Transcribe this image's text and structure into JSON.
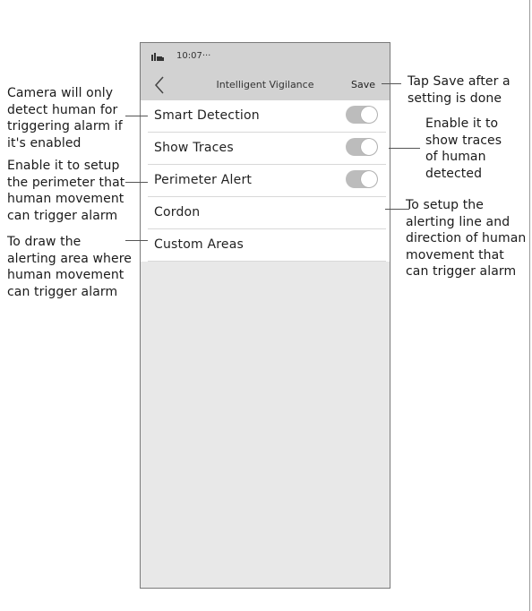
{
  "status_bar": {
    "time": "10:07···",
    "icon": "signal-icon"
  },
  "header": {
    "title": "Intelligent Vigilance",
    "save_label": "Save",
    "back_icon": "chevron-left-icon"
  },
  "settings": [
    {
      "label": "Smart Detection",
      "toggle": true,
      "on": true
    },
    {
      "label": "Show Traces",
      "toggle": true,
      "on": true
    },
    {
      "label": "Perimeter Alert",
      "toggle": true,
      "on": true
    },
    {
      "label": "Cordon",
      "toggle": false
    },
    {
      "label": "Custom Areas",
      "toggle": false
    }
  ],
  "annotations": {
    "smart_detection": "Camera will only\ndetect human for\ntriggering alarm if\nit's enabled",
    "perimeter_alert": "Enable it to setup\nthe perimeter that\nhuman movement\ncan trigger alarm",
    "custom_areas": "To draw the\nalerting area where\nhuman movement\ncan trigger alarm",
    "save": "Tap Save after a\nsetting is done",
    "show_traces": "Enable it to\nshow traces\nof human\ndetected",
    "cordon": "To setup the\nalerting line and\ndirection of human\nmovement that\ncan trigger alarm"
  },
  "colors": {
    "header_bg": "#d2d2d2",
    "body_bg": "#e8e8e8",
    "toggle_on": "#bcbcbc"
  }
}
